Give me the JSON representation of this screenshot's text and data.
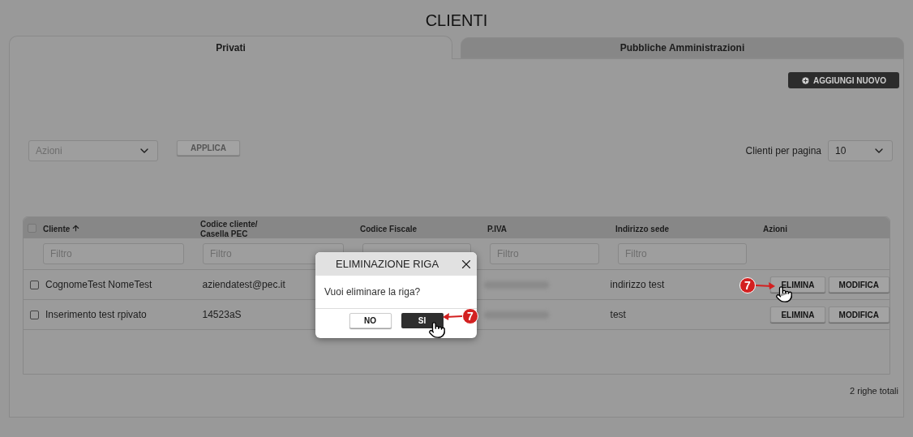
{
  "page_title": "CLIENTI",
  "tabs": [
    {
      "label": "Privati",
      "selected": true
    },
    {
      "label": "Pubbliche Amministrazioni",
      "selected": false
    }
  ],
  "add_button": "AGGIUNGI NUOVO",
  "bulk_actions": {
    "placeholder": "Azioni",
    "apply_button": "APPLICA"
  },
  "page_size": {
    "label": "Clienti per pagina",
    "value": "10"
  },
  "table": {
    "select_all_checked": false,
    "columns": [
      {
        "label": "Cliente",
        "sorted": true,
        "filter_placeholder": "Filtro"
      },
      {
        "label": "Codice cliente/\nCasella PEC",
        "sorted": false,
        "filter_placeholder": "Filtro"
      },
      {
        "label": "Codice Fiscale",
        "sorted": false,
        "filter": true
      },
      {
        "label": "P.IVA",
        "sorted": false,
        "filter_placeholder": "Filtro"
      },
      {
        "label": "Indirizzo sede",
        "sorted": false,
        "filter_placeholder": "Filtro"
      },
      {
        "label": "Azioni",
        "sorted": false
      }
    ],
    "rows": [
      {
        "checked": false,
        "cliente": "CognomeTest NomeTest",
        "codice": "aziendatest@pec.it",
        "indirizzo": "indirizzo test",
        "piva_blurred": true,
        "buttons": [
          "ELIMINA",
          "MODIFICA"
        ]
      },
      {
        "checked": false,
        "cliente": "Inserimento test rpivato",
        "codice": "14523aS",
        "indirizzo": "test",
        "piva_blurred": true,
        "buttons": [
          "ELIMINA",
          "MODIFICA"
        ]
      }
    ]
  },
  "total": "2 righe totali",
  "dialog": {
    "title": "ELIMINAZIONE RIGA",
    "message": "Vuoi eliminare la riga?",
    "buttons": [
      {
        "label": "NO",
        "primary": false
      },
      {
        "label": "SI",
        "primary": true
      }
    ]
  },
  "row_callout": {
    "number": "7"
  },
  "dialog_callout": {
    "number": "7"
  }
}
